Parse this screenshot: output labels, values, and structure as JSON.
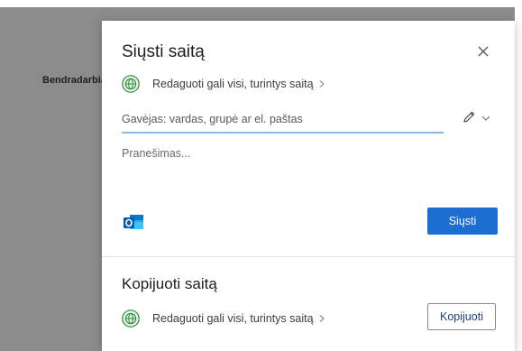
{
  "background": {
    "label": "Bendradarbiavimas"
  },
  "dialog": {
    "title": "Siųsti saitą",
    "permission_link": "Redaguoti gali visi, turintys saitą",
    "to_field": {
      "value": "",
      "placeholder": "Gavėjas: vardas, grupė ar el. paštas"
    },
    "message_field": {
      "value": "",
      "placeholder": "Pranešimas..."
    },
    "send_label": "Siųsti"
  },
  "copy_section": {
    "title": "Kopijuoti saitą",
    "permission_link": "Redaguoti gali visi, turintys saitą",
    "copy_label": "Kopijuoti"
  },
  "colors": {
    "accent": "#1d6ed1",
    "globe_green": "#2e8b3a",
    "backdrop": "#8c8c8c"
  },
  "icons": [
    "close-icon",
    "globe-icon",
    "chevron-right-icon",
    "pencil-icon",
    "chevron-down-icon",
    "outlook-icon"
  ]
}
